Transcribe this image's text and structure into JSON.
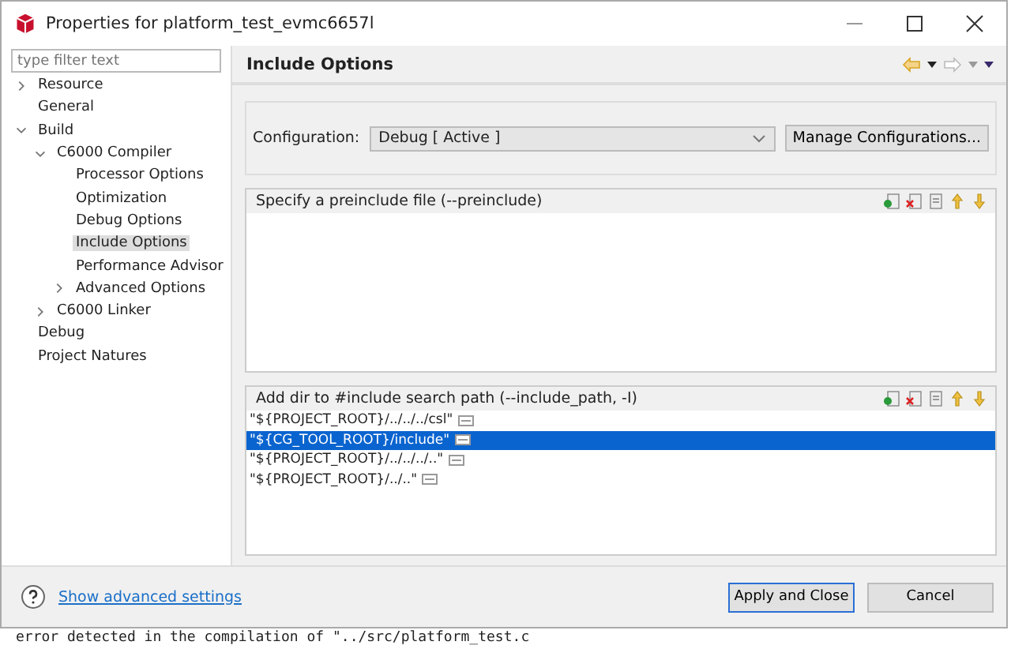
{
  "window": {
    "title": "Properties for platform_test_evmc6657l"
  },
  "sidebar": {
    "filter_placeholder": "type filter text",
    "items": [
      {
        "label": "Resource",
        "expanded": false,
        "selected": false
      },
      {
        "label": "General",
        "selected": false
      },
      {
        "label": "Build",
        "expanded": true,
        "selected": false,
        "children": [
          {
            "label": "C6000 Compiler",
            "expanded": true,
            "selected": false,
            "children": [
              {
                "label": "Processor Options",
                "selected": false
              },
              {
                "label": "Optimization",
                "selected": false
              },
              {
                "label": "Debug Options",
                "selected": false
              },
              {
                "label": "Include Options",
                "selected": true
              },
              {
                "label": "Performance Advisor",
                "selected": false
              },
              {
                "label": "Advanced Options",
                "expanded": false,
                "selected": false
              }
            ]
          },
          {
            "label": "C6000 Linker",
            "expanded": false,
            "selected": false
          }
        ]
      },
      {
        "label": "Debug",
        "selected": false
      },
      {
        "label": "Project Natures",
        "selected": false
      }
    ]
  },
  "page": {
    "title": "Include Options",
    "configuration_label": "Configuration:",
    "configuration_value": "Debug  [ Active ]",
    "manage_button": "Manage Configurations...",
    "lists": [
      {
        "title": "Specify a preinclude file (--preinclude)"
      },
      {
        "title": "Add dir to #include search path (--include_path, -I)",
        "items": [
          {
            "text": "\"${PROJECT_ROOT}/../../../csl\"",
            "selected": false
          },
          {
            "text": "\"${CG_TOOL_ROOT}/include\"",
            "selected": true
          },
          {
            "text": "\"${PROJECT_ROOT}/../../../..\"",
            "selected": false
          },
          {
            "text": "\"${PROJECT_ROOT}/../..\"",
            "selected": false
          }
        ]
      }
    ]
  },
  "footer": {
    "link": "Show advanced settings",
    "buttons": [
      {
        "label": "Apply and Close",
        "default": true
      },
      {
        "label": "Cancel",
        "default": false
      }
    ]
  },
  "background_text": "error detected in the compilation of \"../src/platform_test.c"
}
